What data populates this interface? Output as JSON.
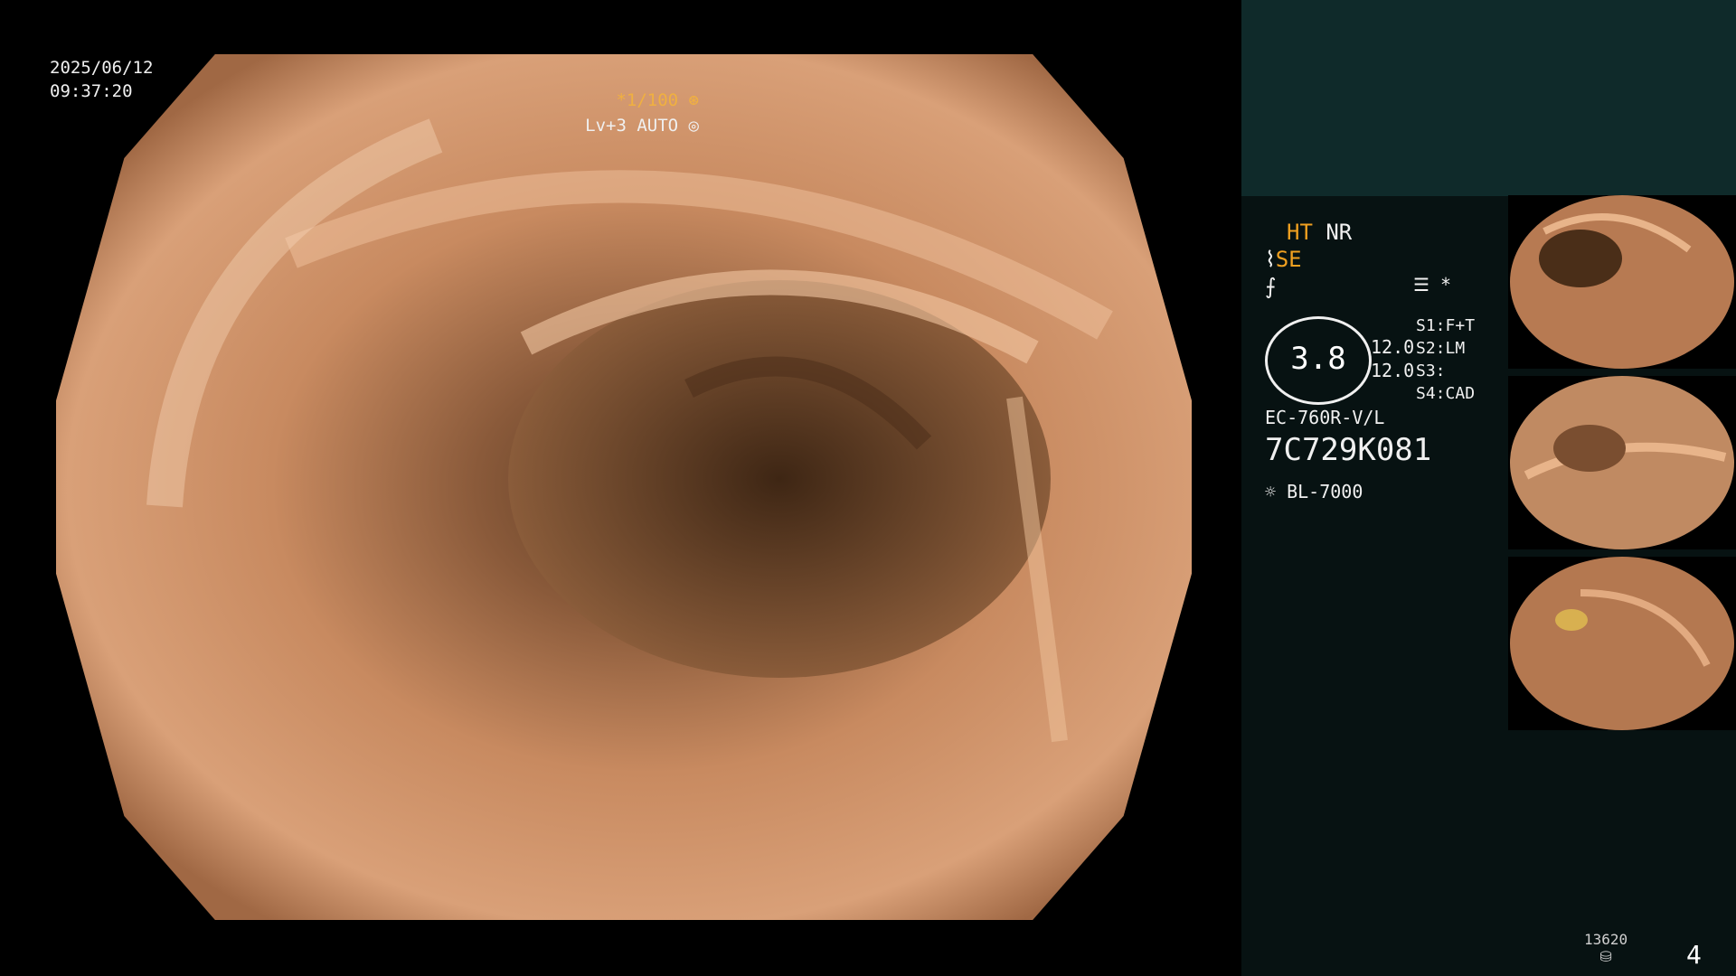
{
  "osd": {
    "date": "2025/06/12",
    "time": "09:37:20",
    "shutter": "*1/100",
    "shutter_icon": "aperture-icon",
    "level": "Lv+3 AUTO",
    "level_icon": "iris-icon"
  },
  "panel": {
    "ht": "HT",
    "nr": "NR",
    "se": "SE",
    "gauge_value": "3.8",
    "val1": "12.0",
    "val2": "12.0",
    "s1": "S1:",
    "s1_val": "F+T",
    "s2": "S2:",
    "s2_val": "LM",
    "s3": "S3:",
    "s3_val": "",
    "s4": "S4:",
    "s4_val": "CAD",
    "scope_model": "EC-760R-V/L",
    "scope_serial": "7C729K081",
    "light_source": "BL-7000",
    "counter": "13620",
    "page": "4"
  },
  "colors": {
    "accent_orange": "#f0a020",
    "panel_bg": "#071212",
    "panel_top_bg": "#0f2a2a"
  }
}
